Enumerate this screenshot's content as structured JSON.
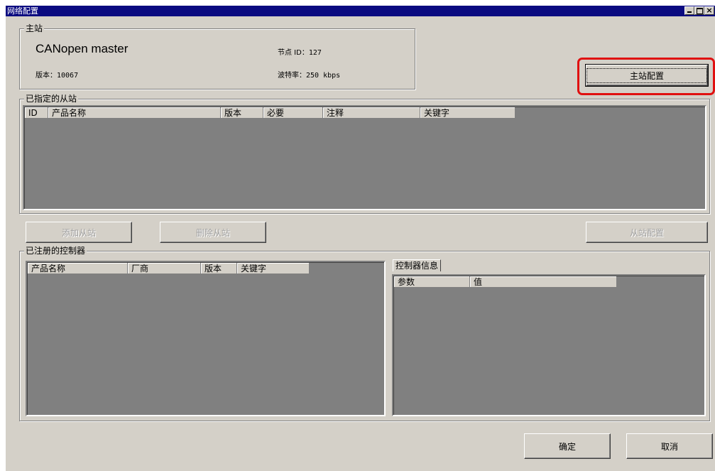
{
  "window": {
    "title": "网络配置",
    "controls": [
      "minimize",
      "maximize",
      "close"
    ],
    "close_glyph": "×"
  },
  "master": {
    "group_label": "主站",
    "name": "CANopen master",
    "version_label": "版本：",
    "version_value": "10067",
    "node_id_label": "节点 ID：",
    "node_id_value": "127",
    "baud_label": "波特率：",
    "baud_value": "250 kbps",
    "config_button": "主站配置"
  },
  "slaves": {
    "group_label": "已指定的从站",
    "columns": [
      "ID",
      "产品名称",
      "版本",
      "必要",
      "注释",
      "关键字"
    ],
    "rows": []
  },
  "slave_buttons": {
    "add": "添加从站",
    "remove": "删除从站",
    "configure": "从站配置"
  },
  "controllers": {
    "group_label": "已注册的控制器",
    "columns": [
      "产品名称",
      "厂商",
      "版本",
      "关键字"
    ],
    "rows": []
  },
  "controller_info": {
    "tab_label": "控制器信息",
    "columns": [
      "参数",
      "值"
    ],
    "rows": []
  },
  "footer": {
    "ok": "确定",
    "cancel": "取消"
  },
  "colors": {
    "titlebar": "#0a0a80",
    "face": "#d4d0c8",
    "list_bg": "#808080",
    "highlight": "#e01010"
  }
}
